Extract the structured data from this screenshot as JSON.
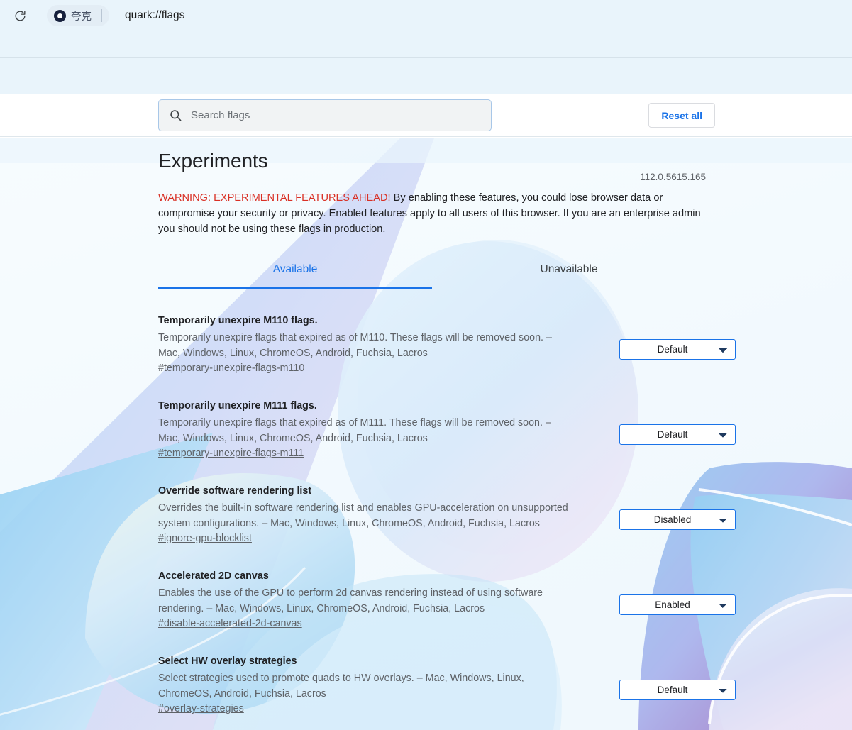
{
  "browser": {
    "reload_icon": "reload-icon",
    "quark_logo_icon": "quark-logo-icon",
    "quark_name": "夸克",
    "url": "quark://flags",
    "bookmark_icon": "star-outline-icon"
  },
  "search": {
    "icon": "search-icon",
    "placeholder": "Search flags",
    "value": "",
    "reset_all_label": "Reset all"
  },
  "page": {
    "title": "Experiments",
    "version": "112.0.5615.165",
    "warning_head": "WARNING: EXPERIMENTAL FEATURES AHEAD!",
    "warning_body": " By enabling these features, you could lose browser data or compromise your security or privacy. Enabled features apply to all users of this browser. If you are an enterprise admin you should not be using these flags in production."
  },
  "tabs": [
    {
      "label": "Available",
      "active": true
    },
    {
      "label": "Unavailable",
      "active": false
    }
  ],
  "select_options": [
    "Default",
    "Enabled",
    "Disabled"
  ],
  "flags": [
    {
      "name": "Temporarily unexpire M110 flags.",
      "description": "Temporarily unexpire flags that expired as of M110. These flags will be removed soon. – Mac, Windows, Linux, ChromeOS, Android, Fuchsia, Lacros",
      "permalink": "#temporary-unexpire-flags-m110",
      "value": "Default"
    },
    {
      "name": "Temporarily unexpire M111 flags.",
      "description": "Temporarily unexpire flags that expired as of M111. These flags will be removed soon. – Mac, Windows, Linux, ChromeOS, Android, Fuchsia, Lacros",
      "permalink": "#temporary-unexpire-flags-m111",
      "value": "Default"
    },
    {
      "name": "Override software rendering list",
      "description": "Overrides the built-in software rendering list and enables GPU-acceleration on unsupported system configurations. – Mac, Windows, Linux, ChromeOS, Android, Fuchsia, Lacros",
      "permalink": "#ignore-gpu-blocklist",
      "value": "Disabled"
    },
    {
      "name": "Accelerated 2D canvas",
      "description": "Enables the use of the GPU to perform 2d canvas rendering instead of using software rendering. – Mac, Windows, Linux, ChromeOS, Android, Fuchsia, Lacros",
      "permalink": "#disable-accelerated-2d-canvas",
      "value": "Enabled"
    },
    {
      "name": "Select HW overlay strategies",
      "description": "Select strategies used to promote quads to HW overlays. – Mac, Windows, Linux, ChromeOS, Android, Fuchsia, Lacros",
      "permalink": "#overlay-strategies",
      "value": "Default"
    }
  ],
  "colors": {
    "accent": "#1a73e8",
    "warning": "#d93025",
    "chrome_bg": "#e9f4fb",
    "page_bg": "#ecf6fc"
  }
}
